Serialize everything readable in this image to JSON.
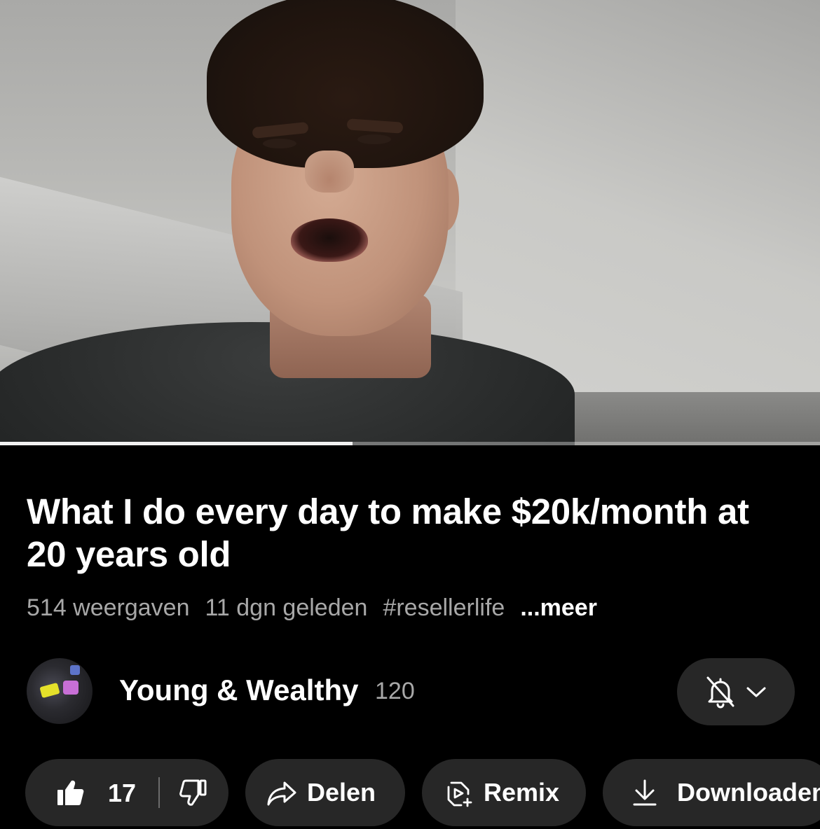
{
  "player": {
    "progress_percent": 43
  },
  "video": {
    "title": "What I do every day to make $20k/month at 20 years old",
    "views": "514 weergaven",
    "age": "11 dgn geleden",
    "hashtag": "#resellerlife",
    "more_label": "...meer"
  },
  "channel": {
    "name": "Young & Wealthy",
    "subscribers": "120"
  },
  "actions": {
    "like_count": "17",
    "share_label": "Delen",
    "remix_label": "Remix",
    "download_label": "Downloaden"
  },
  "icons": {
    "like": "thumbs-up-icon",
    "dislike": "thumbs-down-icon",
    "share": "share-arrow-icon",
    "remix": "remix-icon",
    "download": "download-icon",
    "notifications": "bell-off-icon",
    "dropdown": "chevron-down-icon"
  },
  "colors": {
    "background": "#000000",
    "pill": "#272727",
    "secondary_text": "#a8a8a8"
  }
}
